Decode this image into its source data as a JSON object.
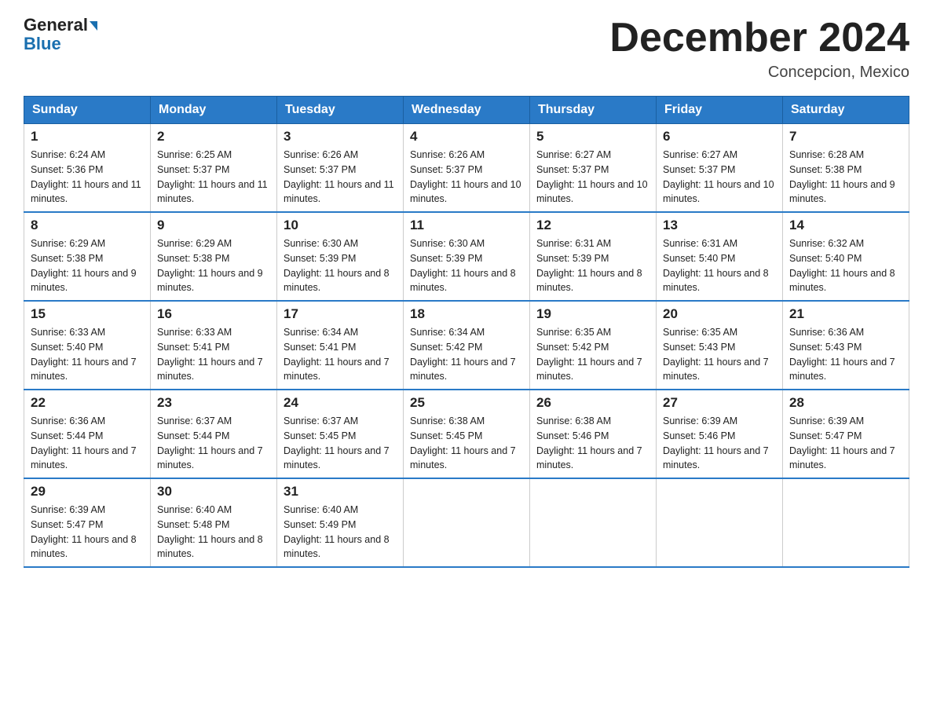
{
  "header": {
    "logo_general": "General",
    "logo_blue": "Blue",
    "month_title": "December 2024",
    "location": "Concepcion, Mexico"
  },
  "days_of_week": [
    "Sunday",
    "Monday",
    "Tuesday",
    "Wednesday",
    "Thursday",
    "Friday",
    "Saturday"
  ],
  "weeks": [
    [
      {
        "day": "1",
        "sunrise": "6:24 AM",
        "sunset": "5:36 PM",
        "daylight": "11 hours and 11 minutes."
      },
      {
        "day": "2",
        "sunrise": "6:25 AM",
        "sunset": "5:37 PM",
        "daylight": "11 hours and 11 minutes."
      },
      {
        "day": "3",
        "sunrise": "6:26 AM",
        "sunset": "5:37 PM",
        "daylight": "11 hours and 11 minutes."
      },
      {
        "day": "4",
        "sunrise": "6:26 AM",
        "sunset": "5:37 PM",
        "daylight": "11 hours and 10 minutes."
      },
      {
        "day": "5",
        "sunrise": "6:27 AM",
        "sunset": "5:37 PM",
        "daylight": "11 hours and 10 minutes."
      },
      {
        "day": "6",
        "sunrise": "6:27 AM",
        "sunset": "5:37 PM",
        "daylight": "11 hours and 10 minutes."
      },
      {
        "day": "7",
        "sunrise": "6:28 AM",
        "sunset": "5:38 PM",
        "daylight": "11 hours and 9 minutes."
      }
    ],
    [
      {
        "day": "8",
        "sunrise": "6:29 AM",
        "sunset": "5:38 PM",
        "daylight": "11 hours and 9 minutes."
      },
      {
        "day": "9",
        "sunrise": "6:29 AM",
        "sunset": "5:38 PM",
        "daylight": "11 hours and 9 minutes."
      },
      {
        "day": "10",
        "sunrise": "6:30 AM",
        "sunset": "5:39 PM",
        "daylight": "11 hours and 8 minutes."
      },
      {
        "day": "11",
        "sunrise": "6:30 AM",
        "sunset": "5:39 PM",
        "daylight": "11 hours and 8 minutes."
      },
      {
        "day": "12",
        "sunrise": "6:31 AM",
        "sunset": "5:39 PM",
        "daylight": "11 hours and 8 minutes."
      },
      {
        "day": "13",
        "sunrise": "6:31 AM",
        "sunset": "5:40 PM",
        "daylight": "11 hours and 8 minutes."
      },
      {
        "day": "14",
        "sunrise": "6:32 AM",
        "sunset": "5:40 PM",
        "daylight": "11 hours and 8 minutes."
      }
    ],
    [
      {
        "day": "15",
        "sunrise": "6:33 AM",
        "sunset": "5:40 PM",
        "daylight": "11 hours and 7 minutes."
      },
      {
        "day": "16",
        "sunrise": "6:33 AM",
        "sunset": "5:41 PM",
        "daylight": "11 hours and 7 minutes."
      },
      {
        "day": "17",
        "sunrise": "6:34 AM",
        "sunset": "5:41 PM",
        "daylight": "11 hours and 7 minutes."
      },
      {
        "day": "18",
        "sunrise": "6:34 AM",
        "sunset": "5:42 PM",
        "daylight": "11 hours and 7 minutes."
      },
      {
        "day": "19",
        "sunrise": "6:35 AM",
        "sunset": "5:42 PM",
        "daylight": "11 hours and 7 minutes."
      },
      {
        "day": "20",
        "sunrise": "6:35 AM",
        "sunset": "5:43 PM",
        "daylight": "11 hours and 7 minutes."
      },
      {
        "day": "21",
        "sunrise": "6:36 AM",
        "sunset": "5:43 PM",
        "daylight": "11 hours and 7 minutes."
      }
    ],
    [
      {
        "day": "22",
        "sunrise": "6:36 AM",
        "sunset": "5:44 PM",
        "daylight": "11 hours and 7 minutes."
      },
      {
        "day": "23",
        "sunrise": "6:37 AM",
        "sunset": "5:44 PM",
        "daylight": "11 hours and 7 minutes."
      },
      {
        "day": "24",
        "sunrise": "6:37 AM",
        "sunset": "5:45 PM",
        "daylight": "11 hours and 7 minutes."
      },
      {
        "day": "25",
        "sunrise": "6:38 AM",
        "sunset": "5:45 PM",
        "daylight": "11 hours and 7 minutes."
      },
      {
        "day": "26",
        "sunrise": "6:38 AM",
        "sunset": "5:46 PM",
        "daylight": "11 hours and 7 minutes."
      },
      {
        "day": "27",
        "sunrise": "6:39 AM",
        "sunset": "5:46 PM",
        "daylight": "11 hours and 7 minutes."
      },
      {
        "day": "28",
        "sunrise": "6:39 AM",
        "sunset": "5:47 PM",
        "daylight": "11 hours and 7 minutes."
      }
    ],
    [
      {
        "day": "29",
        "sunrise": "6:39 AM",
        "sunset": "5:47 PM",
        "daylight": "11 hours and 8 minutes."
      },
      {
        "day": "30",
        "sunrise": "6:40 AM",
        "sunset": "5:48 PM",
        "daylight": "11 hours and 8 minutes."
      },
      {
        "day": "31",
        "sunrise": "6:40 AM",
        "sunset": "5:49 PM",
        "daylight": "11 hours and 8 minutes."
      },
      null,
      null,
      null,
      null
    ]
  ],
  "labels": {
    "sunrise": "Sunrise:",
    "sunset": "Sunset:",
    "daylight": "Daylight:"
  }
}
